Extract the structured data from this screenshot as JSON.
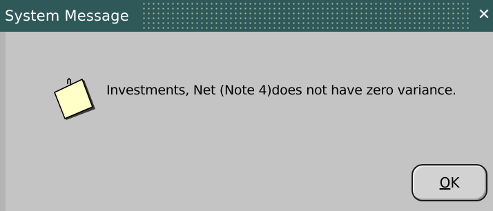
{
  "window": {
    "title": "System Message",
    "close_glyph": "✕"
  },
  "message": {
    "text": "Investments, Net (Note 4)does not have zero variance.",
    "icon": "note-icon"
  },
  "buttons": {
    "ok_mnemonic": "O",
    "ok_rest": "K"
  },
  "colors": {
    "titlebar": "#2f5859",
    "background": "#c4c4c4",
    "note_fill": "#ffffc8"
  }
}
